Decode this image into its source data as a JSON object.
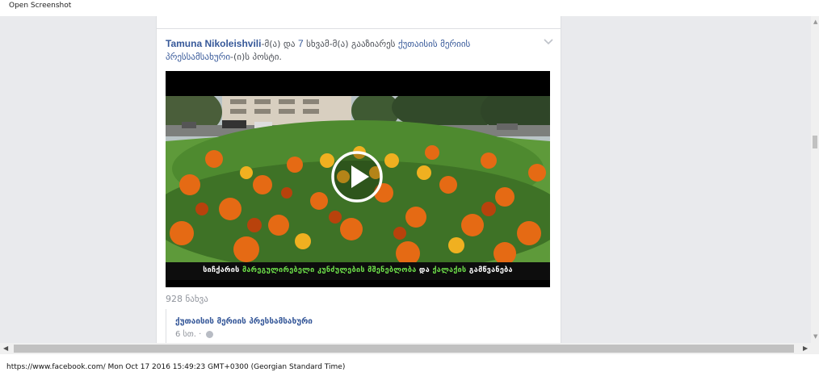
{
  "window": {
    "title": "Open Screenshot"
  },
  "post": {
    "author": "Tamuna Nikoleishvili",
    "text_part1": "-მ(ა) და ",
    "count": "7",
    "text_part2": " სხვამ-მ(ა) გააზიარეს ",
    "page_link": "ქუთაისის მერიის პრესსამსახური",
    "text_part3": "-(ი)ს პოსტი.",
    "video_caption_white1": "სიჩქარის ",
    "video_caption_green1": "მარეგულირებელი კუნძულების მშენებლობა",
    "video_caption_white2": " და ",
    "video_caption_green2": "ქალაქის",
    "video_caption_white3": " გამწვანება",
    "views": "928 ნახვა",
    "shared_from": "ქუთაისის მერიის პრესსამსახური",
    "shared_time": "6 სთ. ·",
    "icons": [
      "chevron-down-icon",
      "play-icon",
      "globe-icon"
    ]
  },
  "status_bar": {
    "text": "https://www.facebook.com/ Mon Oct 17 2016 15:49:23 GMT+0300 (Georgian Standard Time)"
  },
  "colors": {
    "link": "#365899",
    "background": "#e9eaed",
    "caption_green": "#6ee04a"
  }
}
